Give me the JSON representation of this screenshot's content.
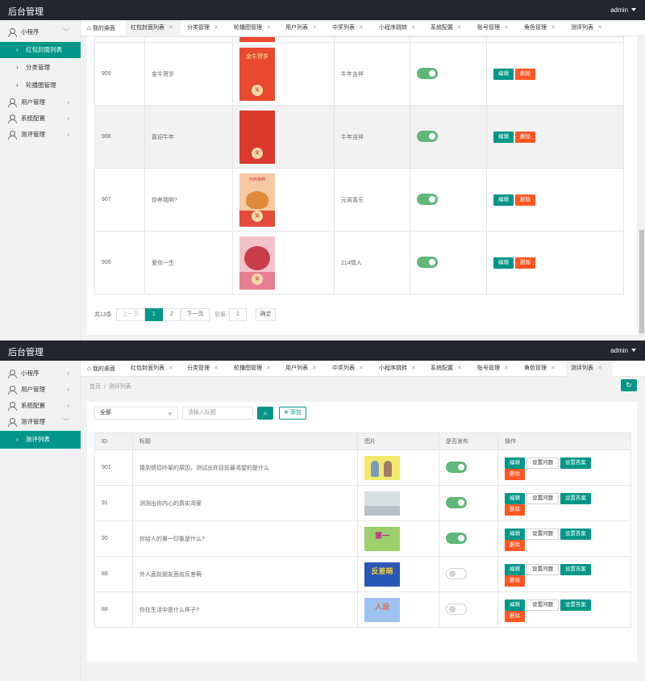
{
  "app": {
    "brand": "后台管理",
    "user": "admin"
  },
  "colors": {
    "primary": "#009688",
    "danger": "#ff5722",
    "switch_on": "#5fb878",
    "topbar": "#23262e"
  },
  "panel1": {
    "sidebar": [
      {
        "label": "小程序",
        "icon": "user-icon",
        "arrow": "﹀"
      },
      {
        "label": "红包封面列表",
        "active": true,
        "arrow": "›"
      },
      {
        "label": "分类管理",
        "arrow": "›"
      },
      {
        "label": "轮播图管理",
        "arrow": "›"
      },
      {
        "label": "用户管理",
        "icon": "user-icon",
        "arrow": "‹"
      },
      {
        "label": "系统配置",
        "icon": "user-icon",
        "arrow": "‹"
      },
      {
        "label": "测评管理",
        "icon": "user-icon",
        "arrow": "‹"
      }
    ],
    "tabs": [
      "我的桌面",
      "红包封面列表",
      "分类管理",
      "轮播图管理",
      "用户列表",
      "中奖列表",
      "小程序跳转",
      "系统配置",
      "账号管理",
      "角色管理",
      "测评列表"
    ],
    "active_tab": "红包封面列表",
    "rows": [
      {
        "id": "909",
        "title": "金牛贺岁",
        "poster_text": "金牛贺岁",
        "poster_color": "#e8492f",
        "category": "牛年吉祥",
        "published": true
      },
      {
        "id": "908",
        "title": "喜迎牛年",
        "poster_text": "",
        "poster_color": "#d93a2b",
        "category": "牛年吉祥",
        "published": true
      },
      {
        "id": "907",
        "title": "你养我啊?",
        "poster_text": "你养我啊",
        "poster_color": "#f6c9a3",
        "category": "元宵喜乐",
        "published": true
      },
      {
        "id": "906",
        "title": "爱你一生",
        "poster_text": "",
        "poster_color": "#f3c2c9",
        "category": "214情人",
        "published": true
      }
    ],
    "buttons": {
      "edit": "编辑",
      "delete": "删除"
    },
    "seal_text": "開",
    "pager": {
      "total": "共13条",
      "prev": "上一页",
      "pages": [
        "1",
        "2"
      ],
      "current": "1",
      "next": "下一页",
      "goto": "到第",
      "page_input": "1",
      "confirm": "确定"
    }
  },
  "panel2": {
    "sidebar": [
      {
        "label": "小程序",
        "icon": "user-icon",
        "arrow": "‹"
      },
      {
        "label": "用户管理",
        "icon": "user-icon",
        "arrow": "‹"
      },
      {
        "label": "系统配置",
        "icon": "user-icon",
        "arrow": "‹"
      },
      {
        "label": "测评管理",
        "icon": "user-icon",
        "arrow": "﹀"
      },
      {
        "label": "测评列表",
        "active": true,
        "arrow": "›"
      }
    ],
    "tabs": [
      "我的桌面",
      "红包封面列表",
      "分类管理",
      "轮播图管理",
      "用户列表",
      "中奖列表",
      "小程序跳转",
      "系统配置",
      "账号管理",
      "角色管理",
      "测评列表"
    ],
    "active_tab": "测评列表",
    "breadcrumb": [
      "首页",
      "测评列表"
    ],
    "filter": {
      "select_value": "全部",
      "search_placeholder": "请输入标题",
      "add_label": "添加"
    },
    "headers": [
      "ID",
      "标题",
      "图片",
      "是否发布",
      "操作"
    ],
    "rows": [
      {
        "id": "901",
        "title": "猜到情侣吵架的原因，测试出你目前最渴望的是什么",
        "thumb_color": "#f2e86a",
        "thumb_text": "",
        "published": true
      },
      {
        "id": "91",
        "title": "测测出你内心的真实渴爱",
        "thumb_color": "#d8dde0",
        "thumb_text": "",
        "published": true
      },
      {
        "id": "90",
        "title": "你给人的第一印象是什么?",
        "thumb_color": "#9bd06a",
        "thumb_text": "第一",
        "published": true
      },
      {
        "id": "89",
        "title": "外人面前朋友面前反差萌",
        "thumb_color": "#2a58b8",
        "thumb_text": "反差萌",
        "published": false
      },
      {
        "id": "88",
        "title": "你在生活中是什么样子?",
        "thumb_color": "#9ec3f0",
        "thumb_text": "人设",
        "published": false
      }
    ],
    "buttons": {
      "edit": "编辑",
      "set_question": "设置问题",
      "set_answer": "设置答案",
      "delete": "删除"
    }
  }
}
